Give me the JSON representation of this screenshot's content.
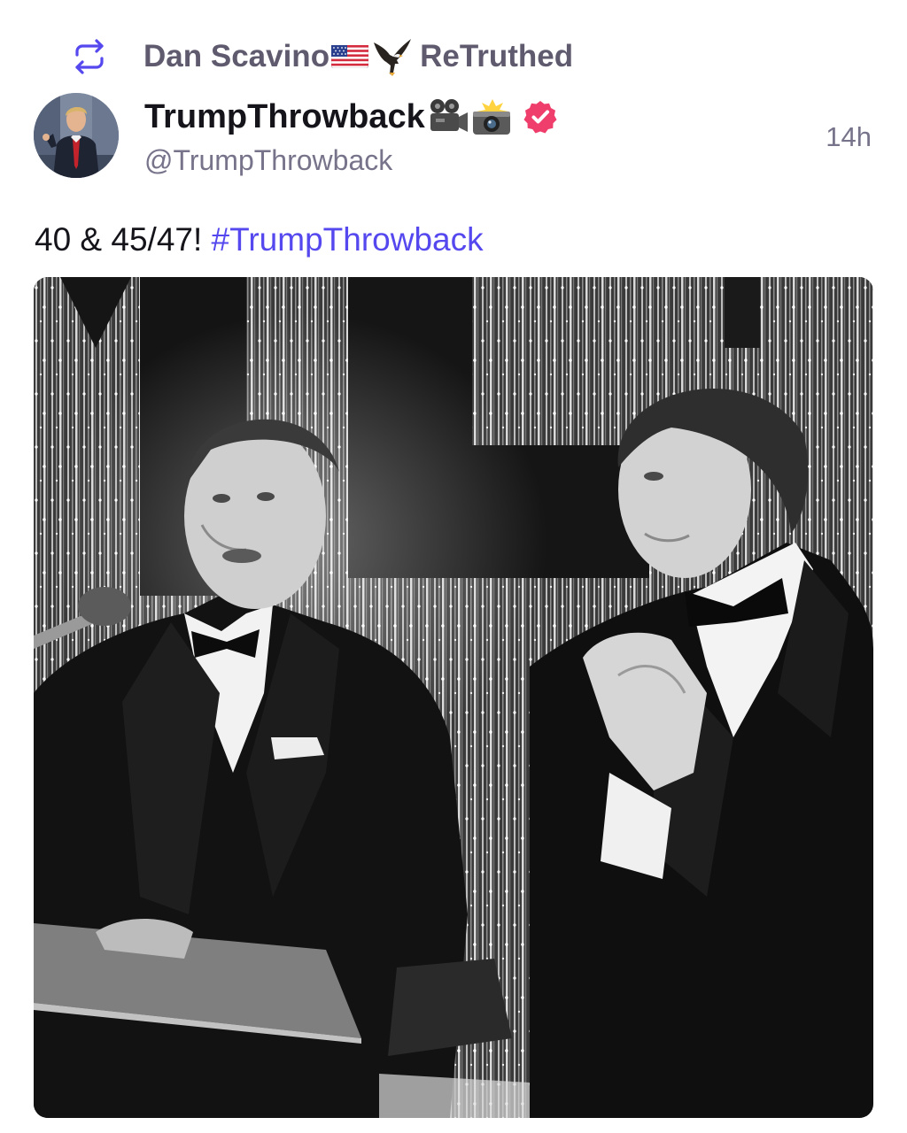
{
  "retruth": {
    "icon": "retruth-icon",
    "user_name": "Dan Scavino",
    "user_emojis": [
      "us-flag-emoji",
      "eagle-emoji"
    ],
    "action_label": "ReTruthed"
  },
  "author": {
    "name": "TrumpThrowback",
    "name_emojis": [
      "movie-camera-emoji",
      "camera-flash-emoji"
    ],
    "handle": "@TrumpThrowback",
    "verified_icon": "verified-badge-icon",
    "avatar_icon": "avatar"
  },
  "post": {
    "timestamp": "14h",
    "text_prefix": "40 & 45/47! ",
    "hashtag": "#TrumpThrowback"
  },
  "colors": {
    "accent": "#5448ee",
    "verified": "#ef3e6b",
    "muted": "#77738a",
    "text": "#15141a"
  },
  "media": {
    "type": "black-and-white photo"
  }
}
